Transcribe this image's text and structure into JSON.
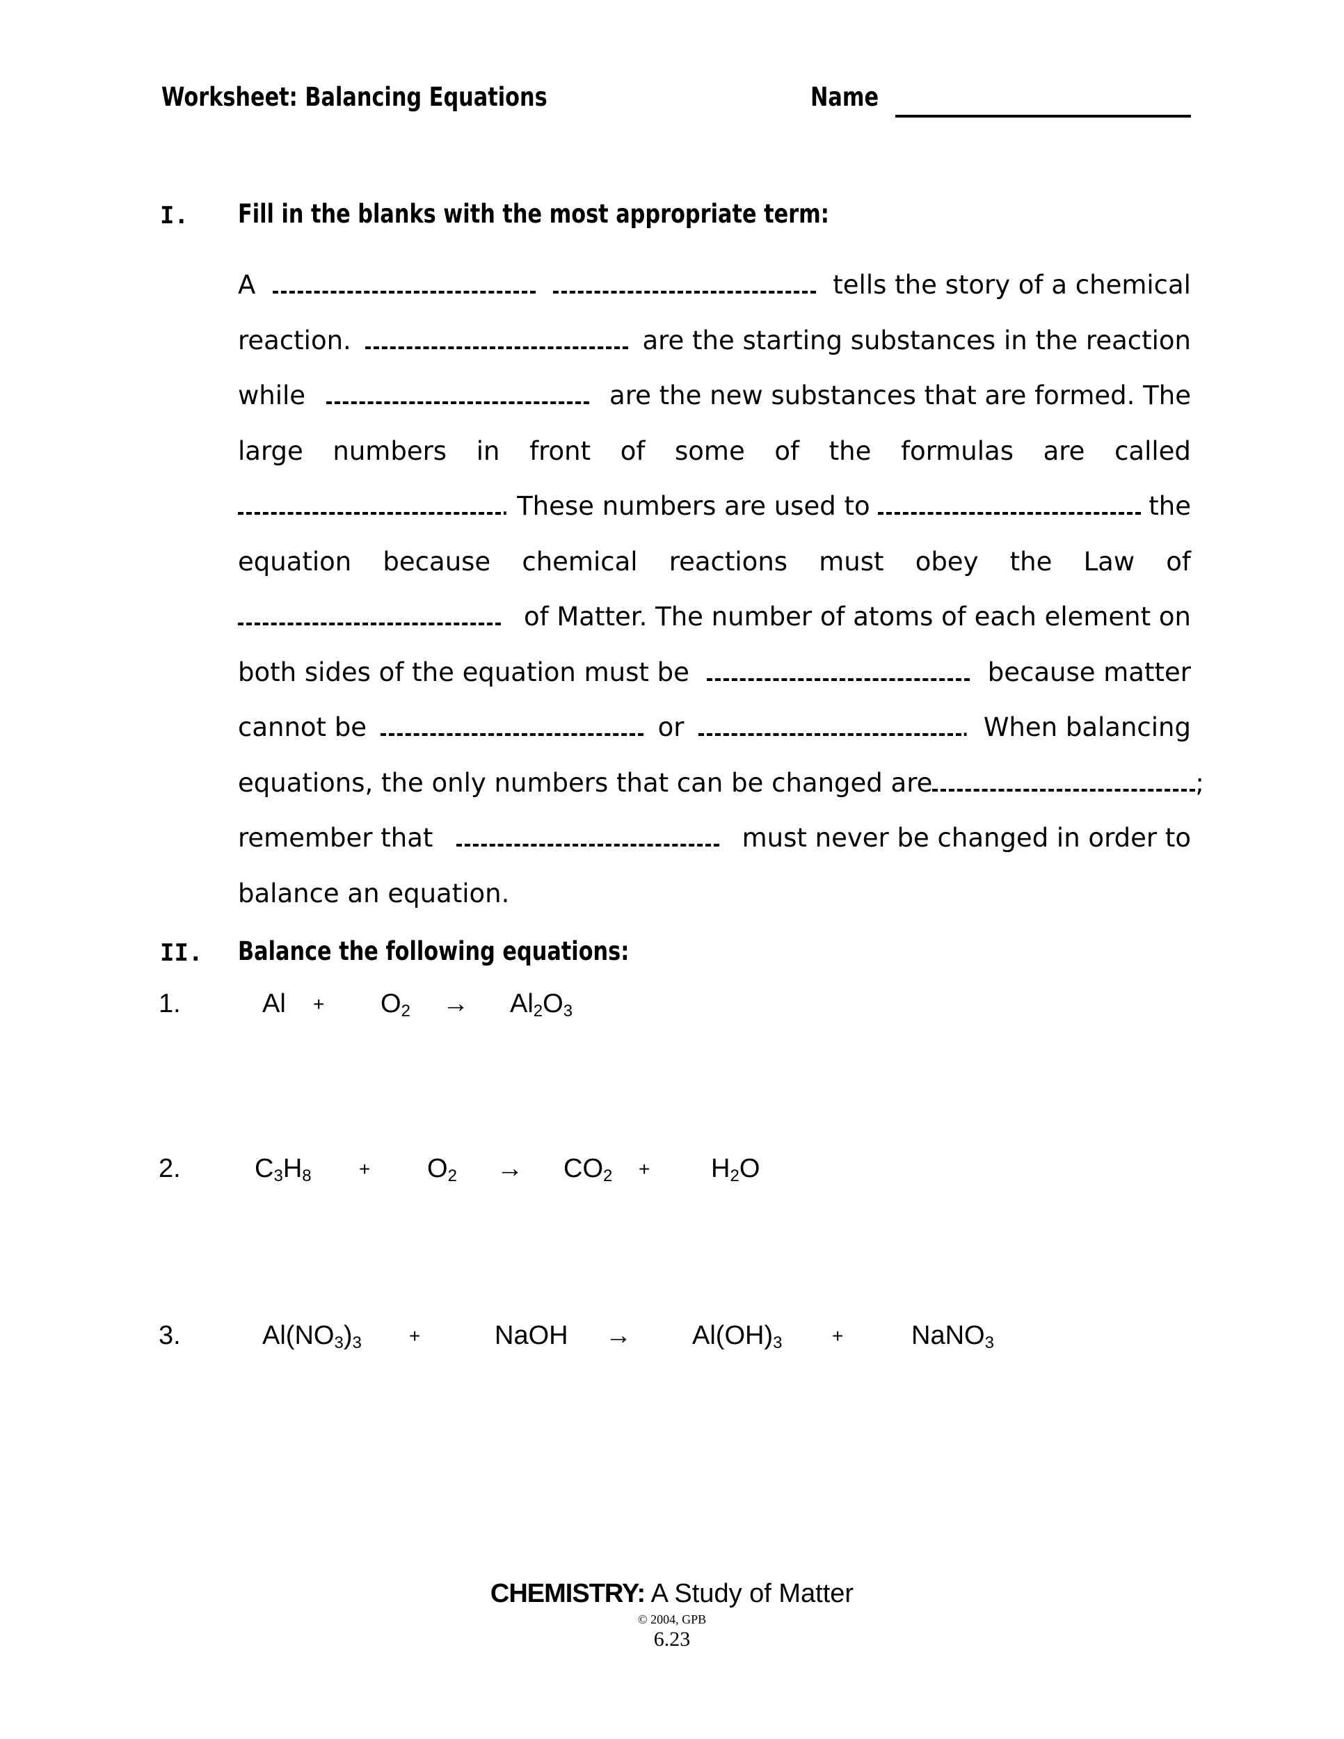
{
  "header": {
    "title": "Worksheet:  Balancing Equations",
    "name_label": "Name"
  },
  "section1": {
    "numeral": "I.",
    "heading": "Fill in the blanks with the most appropriate term:",
    "lines": [
      [
        "A",
        "_BLANK_",
        "_BLANK_",
        "tells the story of a chemical"
      ],
      [
        "reaction.",
        "_BLANK_",
        "are the starting substances in the reaction"
      ],
      [
        "while",
        "_BLANK_",
        "are the new substances that are formed.  The"
      ],
      [
        "large",
        "numbers",
        "in",
        "front",
        "of",
        "some",
        "of",
        "the",
        "formulas",
        "are",
        "called"
      ],
      [
        "_BLANK_.",
        "These numbers are used to",
        "_BLANK_",
        "the"
      ],
      [
        "equation",
        "because",
        "chemical",
        "reactions",
        "must",
        "obey",
        "the",
        "Law",
        "of"
      ],
      [
        "_BLANK_",
        "of Matter.  The number of atoms of each element on"
      ],
      [
        "both sides of the equation must be",
        "_BLANK_",
        "because matter"
      ],
      [
        "cannot be",
        "_BLANK_",
        "or",
        "_BLANK_.",
        "When balancing"
      ],
      [
        "equations, the only numbers that can be changed are",
        "_BLANK_;"
      ],
      [
        "remember that",
        "_BLANK_",
        "must never be changed in order to"
      ],
      [
        "balance an equation."
      ]
    ]
  },
  "section2": {
    "numeral": "II.",
    "heading": "Balance the following equations:",
    "equations": [
      {
        "number": "1.",
        "terms": [
          {
            "type": "formula",
            "parts": [
              [
                "Al",
                ""
              ]
            ]
          },
          {
            "type": "op",
            "text": "+"
          },
          {
            "type": "formula",
            "parts": [
              [
                "O",
                "2"
              ]
            ]
          },
          {
            "type": "op",
            "text": "→"
          },
          {
            "type": "formula",
            "parts": [
              [
                "Al",
                "2"
              ],
              [
                "O",
                "3"
              ]
            ]
          }
        ]
      },
      {
        "number": "2.",
        "terms": [
          {
            "type": "formula",
            "parts": [
              [
                "C",
                "3"
              ],
              [
                "H",
                "8"
              ]
            ]
          },
          {
            "type": "op",
            "text": "+"
          },
          {
            "type": "formula",
            "parts": [
              [
                "O",
                "2"
              ]
            ]
          },
          {
            "type": "op",
            "text": "→"
          },
          {
            "type": "formula",
            "parts": [
              [
                "CO",
                "2"
              ]
            ]
          },
          {
            "type": "op",
            "text": "+"
          },
          {
            "type": "formula",
            "parts": [
              [
                "H",
                "2"
              ],
              [
                "O",
                ""
              ]
            ]
          }
        ]
      },
      {
        "number": "3.",
        "terms": [
          {
            "type": "formula",
            "parts": [
              [
                "Al(NO",
                "3"
              ],
              [
                ")",
                "3"
              ]
            ]
          },
          {
            "type": "op",
            "text": "+"
          },
          {
            "type": "formula",
            "parts": [
              [
                "NaOH",
                ""
              ]
            ]
          },
          {
            "type": "op",
            "text": "→"
          },
          {
            "type": "formula",
            "parts": [
              [
                "Al(OH)",
                "3"
              ]
            ]
          },
          {
            "type": "op",
            "text": "+"
          },
          {
            "type": "formula",
            "parts": [
              [
                "NaNO",
                "3"
              ]
            ]
          }
        ]
      }
    ]
  },
  "footer": {
    "book_bold": "CHEMISTRY:",
    "book_rest": " A Study of Matter",
    "copyright": "© 2004, GPB",
    "page_number": "6.23"
  }
}
